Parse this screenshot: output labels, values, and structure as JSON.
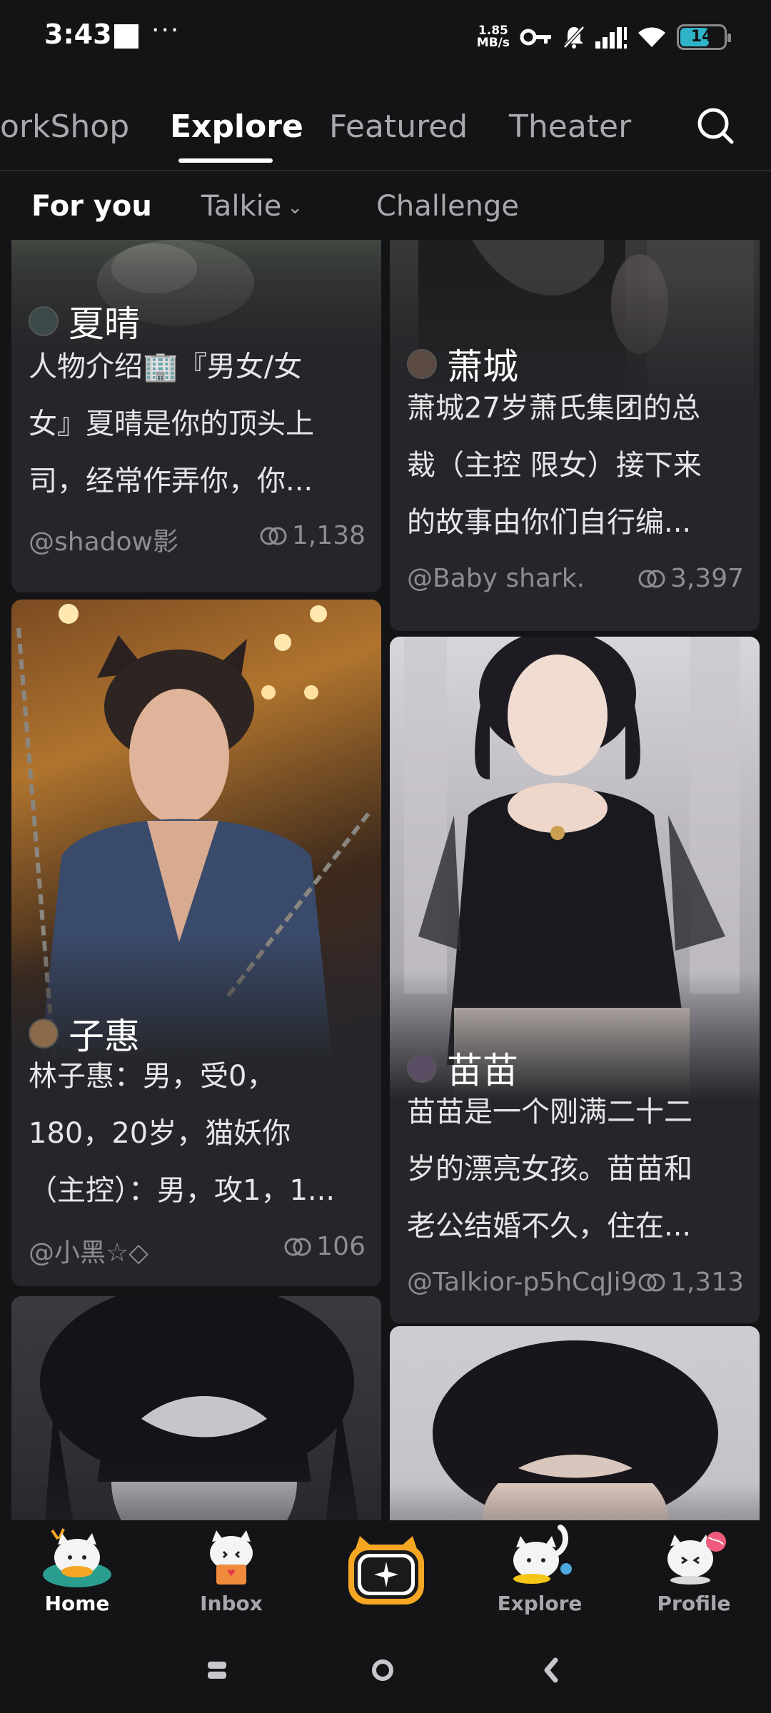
{
  "status_bar": {
    "time": "3:43",
    "dots": "···",
    "net_speed_value": "1.85",
    "net_speed_unit": "MB/s",
    "battery_level": "14",
    "icons": [
      "key-icon",
      "mute-bell-icon",
      "signal-icon",
      "wifi-icon",
      "battery-icon"
    ]
  },
  "top_tabs": [
    {
      "label": "orkShop"
    },
    {
      "label": "Explore",
      "active": true
    },
    {
      "label": "Featured"
    },
    {
      "label": "Theater"
    }
  ],
  "sub_tabs": [
    {
      "label": "For you",
      "active": true
    },
    {
      "label": "Talkie"
    },
    {
      "label": "Challenge"
    }
  ],
  "cards": [
    {
      "name": "夏晴",
      "desc_lines": [
        "人物介绍🏢『男女/女",
        "女』夏晴是你的顶头上",
        "司，经常作弄你，你..."
      ],
      "author": "@shadow影",
      "count": "1,138"
    },
    {
      "name": "萧城",
      "desc_lines": [
        "萧城27岁萧氏集团的总",
        "裁（主控 限女）接下来",
        "的故事由你们自行编..."
      ],
      "author": "@Baby shark.",
      "count": "3,397"
    },
    {
      "name": "子惠",
      "desc_lines": [
        "林子惠：男，受0，",
        "180，20岁，猫妖你",
        "（主控）：男，攻1，1..."
      ],
      "author": "@小黑☆◇",
      "count": "106"
    },
    {
      "name": "苗苗",
      "desc_lines": [
        "苗苗是一个刚满二十二",
        "岁的漂亮女孩。苗苗和",
        "老公结婚不久，住在..."
      ],
      "author": "@Talkior-p5hCqJi9",
      "count": "1,313"
    }
  ],
  "bottom_nav": [
    {
      "label": "Home",
      "icon": "cat-home-icon",
      "active": true
    },
    {
      "label": "Inbox",
      "icon": "cat-inbox-icon"
    },
    {
      "label": "Explore",
      "icon": "cat-explore-icon"
    },
    {
      "label": "Profile",
      "icon": "cat-profile-icon"
    }
  ],
  "colors": {
    "background": "#141416",
    "card": "#26262a",
    "accent": "#f5a623",
    "muted_text": "#8d8d92"
  }
}
